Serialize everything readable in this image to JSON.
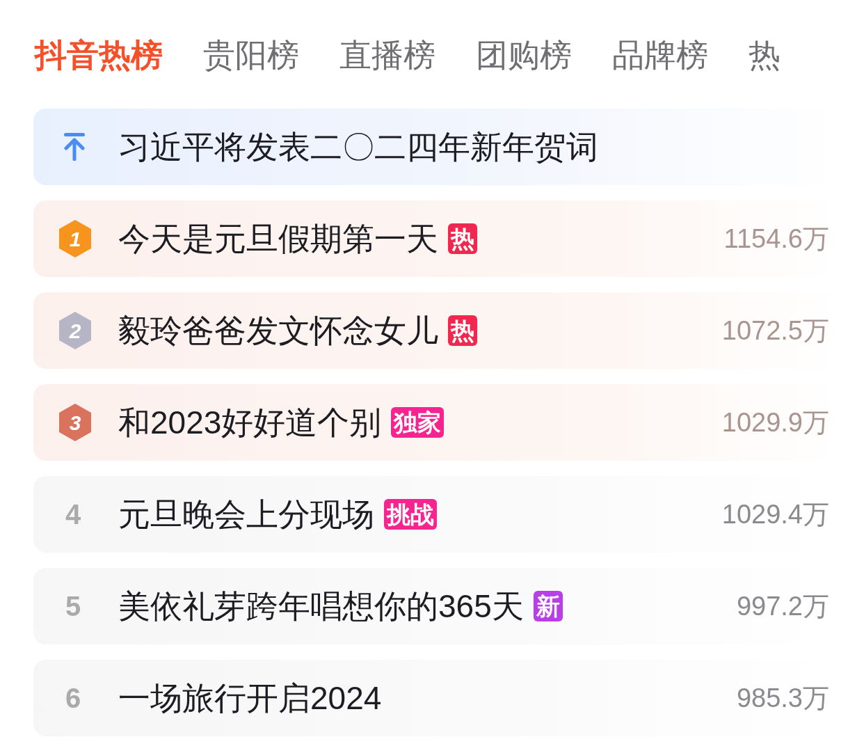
{
  "tabs": [
    {
      "label": "抖音热榜",
      "selected": true
    },
    {
      "label": "贵阳榜",
      "selected": false
    },
    {
      "label": "直播榜",
      "selected": false
    },
    {
      "label": "团购榜",
      "selected": false
    },
    {
      "label": "品牌榜",
      "selected": false
    },
    {
      "label": "热",
      "selected": false
    }
  ],
  "items": [
    {
      "kind": "pinned",
      "title": "习近平将发表二〇二四年新年贺词"
    },
    {
      "kind": "top",
      "rank": "1",
      "color": "#f7941d",
      "title": "今天是元旦假期第一天",
      "tag": {
        "label": "热",
        "color": "#f2274f"
      },
      "heat": "1154.6万"
    },
    {
      "kind": "top",
      "rank": "2",
      "color": "#b5b5c6",
      "title": "毅玲爸爸发文怀念女儿",
      "tag": {
        "label": "热",
        "color": "#f2274f"
      },
      "heat": "1072.5万"
    },
    {
      "kind": "top",
      "rank": "3",
      "color": "#d9735e",
      "title": "和2023好好道个别",
      "tag": {
        "label": "独家",
        "color": "#f5248f"
      },
      "heat": "1029.9万"
    },
    {
      "kind": "plain",
      "rank": "4",
      "title": "元旦晚会上分现场",
      "tag": {
        "label": "挑战",
        "color": "#f5248f"
      },
      "heat": "1029.4万"
    },
    {
      "kind": "plain",
      "rank": "5",
      "title": "美依礼芽跨年唱想你的365天",
      "tag": {
        "label": "新",
        "color": "#b93ee8"
      },
      "heat": "997.2万"
    },
    {
      "kind": "plain",
      "rank": "6",
      "title": "一场旅行开启2024",
      "heat": "985.3万"
    }
  ]
}
